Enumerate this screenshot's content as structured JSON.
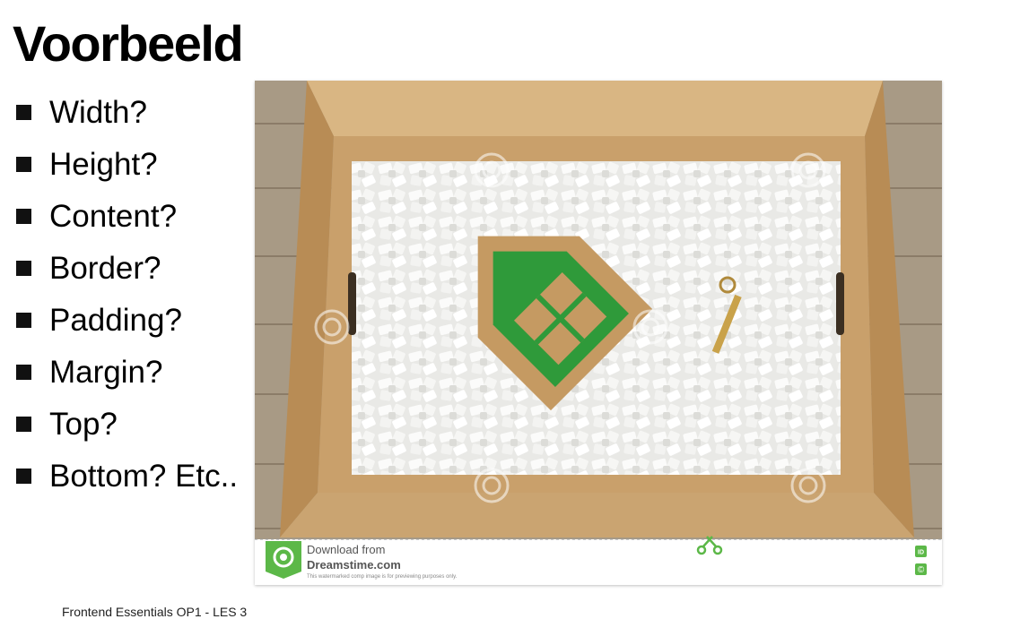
{
  "slide": {
    "title": "Voorbeeld",
    "bullets": [
      "Width?",
      "Height?",
      "Content?",
      "Border?",
      "Padding?",
      "Margin?",
      "Top?",
      "Bottom? Etc.."
    ],
    "footer": "Frontend Essentials OP1 - LES 3"
  },
  "image": {
    "alt": "Moving box with packing peanuts, green house figure and key",
    "watermark": "dreamstime",
    "banner_line1": "Download from",
    "banner_line2": "Dreamstime.com",
    "banner_small": "This watermarked comp image is for previewing purposes only.",
    "badge_id": "ID",
    "badge_copyright": "©"
  },
  "colors": {
    "house_green": "#2f9a3a",
    "cardboard": "#c9a06b",
    "wood": "#a89a85",
    "dreamstime_green": "#5cb848"
  }
}
